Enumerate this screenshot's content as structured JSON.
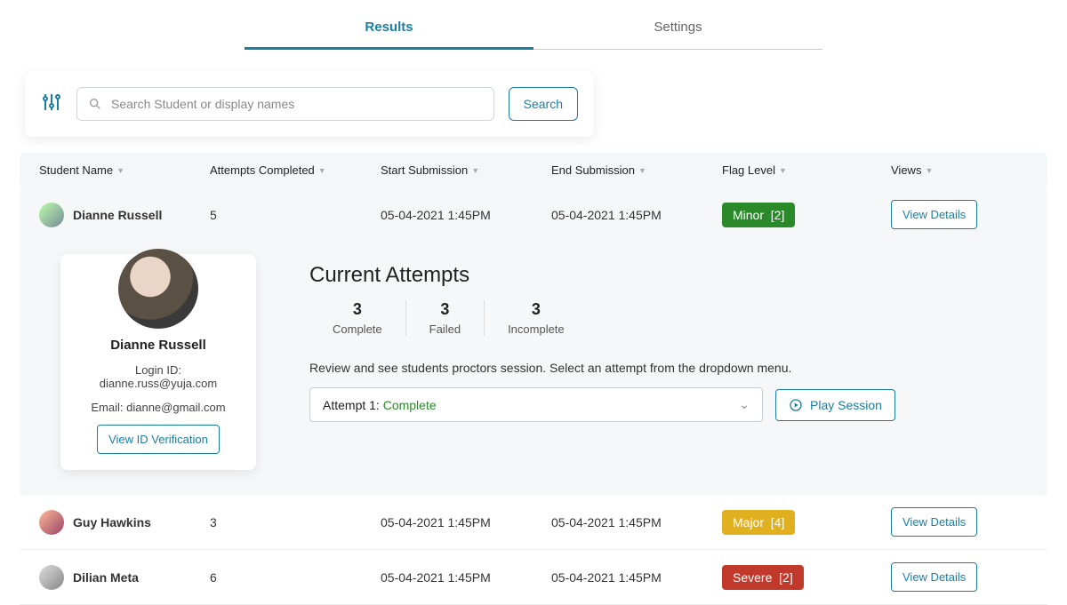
{
  "tabs": {
    "results": "Results",
    "settings": "Settings"
  },
  "search": {
    "placeholder": "Search Student or display names",
    "button": "Search"
  },
  "columns": {
    "name": "Student Name",
    "attempts": "Attempts Completed",
    "start": "Start Submission",
    "end": "End Submission",
    "flag": "Flag Level",
    "views": "Views"
  },
  "rows": [
    {
      "name": "Dianne Russell",
      "attempts": "5",
      "start": "05-04-2021 1:45PM",
      "end": "05-04-2021 1:45PM",
      "flagLabel": "Minor",
      "flagCount": "[2]",
      "view": "View Details"
    },
    {
      "name": "Guy Hawkins",
      "attempts": "3",
      "start": "05-04-2021 1:45PM",
      "end": "05-04-2021 1:45PM",
      "flagLabel": "Major",
      "flagCount": "[4]",
      "view": "View Details"
    },
    {
      "name": "Dilian Meta",
      "attempts": "6",
      "start": "05-04-2021 1:45PM",
      "end": "05-04-2021 1:45PM",
      "flagLabel": "Severe",
      "flagCount": "[2]",
      "view": "View Details"
    }
  ],
  "profile": {
    "name": "Dianne Russell",
    "login": "Login ID: dianne.russ@yuja.com",
    "email": "Email: dianne@gmail.com",
    "idbtn": "View ID Verification"
  },
  "detail": {
    "title": "Current Attempts",
    "stats": [
      {
        "n": "3",
        "l": "Complete"
      },
      {
        "n": "3",
        "l": "Failed"
      },
      {
        "n": "3",
        "l": "Incomplete"
      }
    ],
    "review": "Review and see students proctors session. Select an attempt from the dropdown menu.",
    "attemptPrefix": "Attempt 1: ",
    "attemptStatus": "Complete",
    "play": "Play Session"
  }
}
